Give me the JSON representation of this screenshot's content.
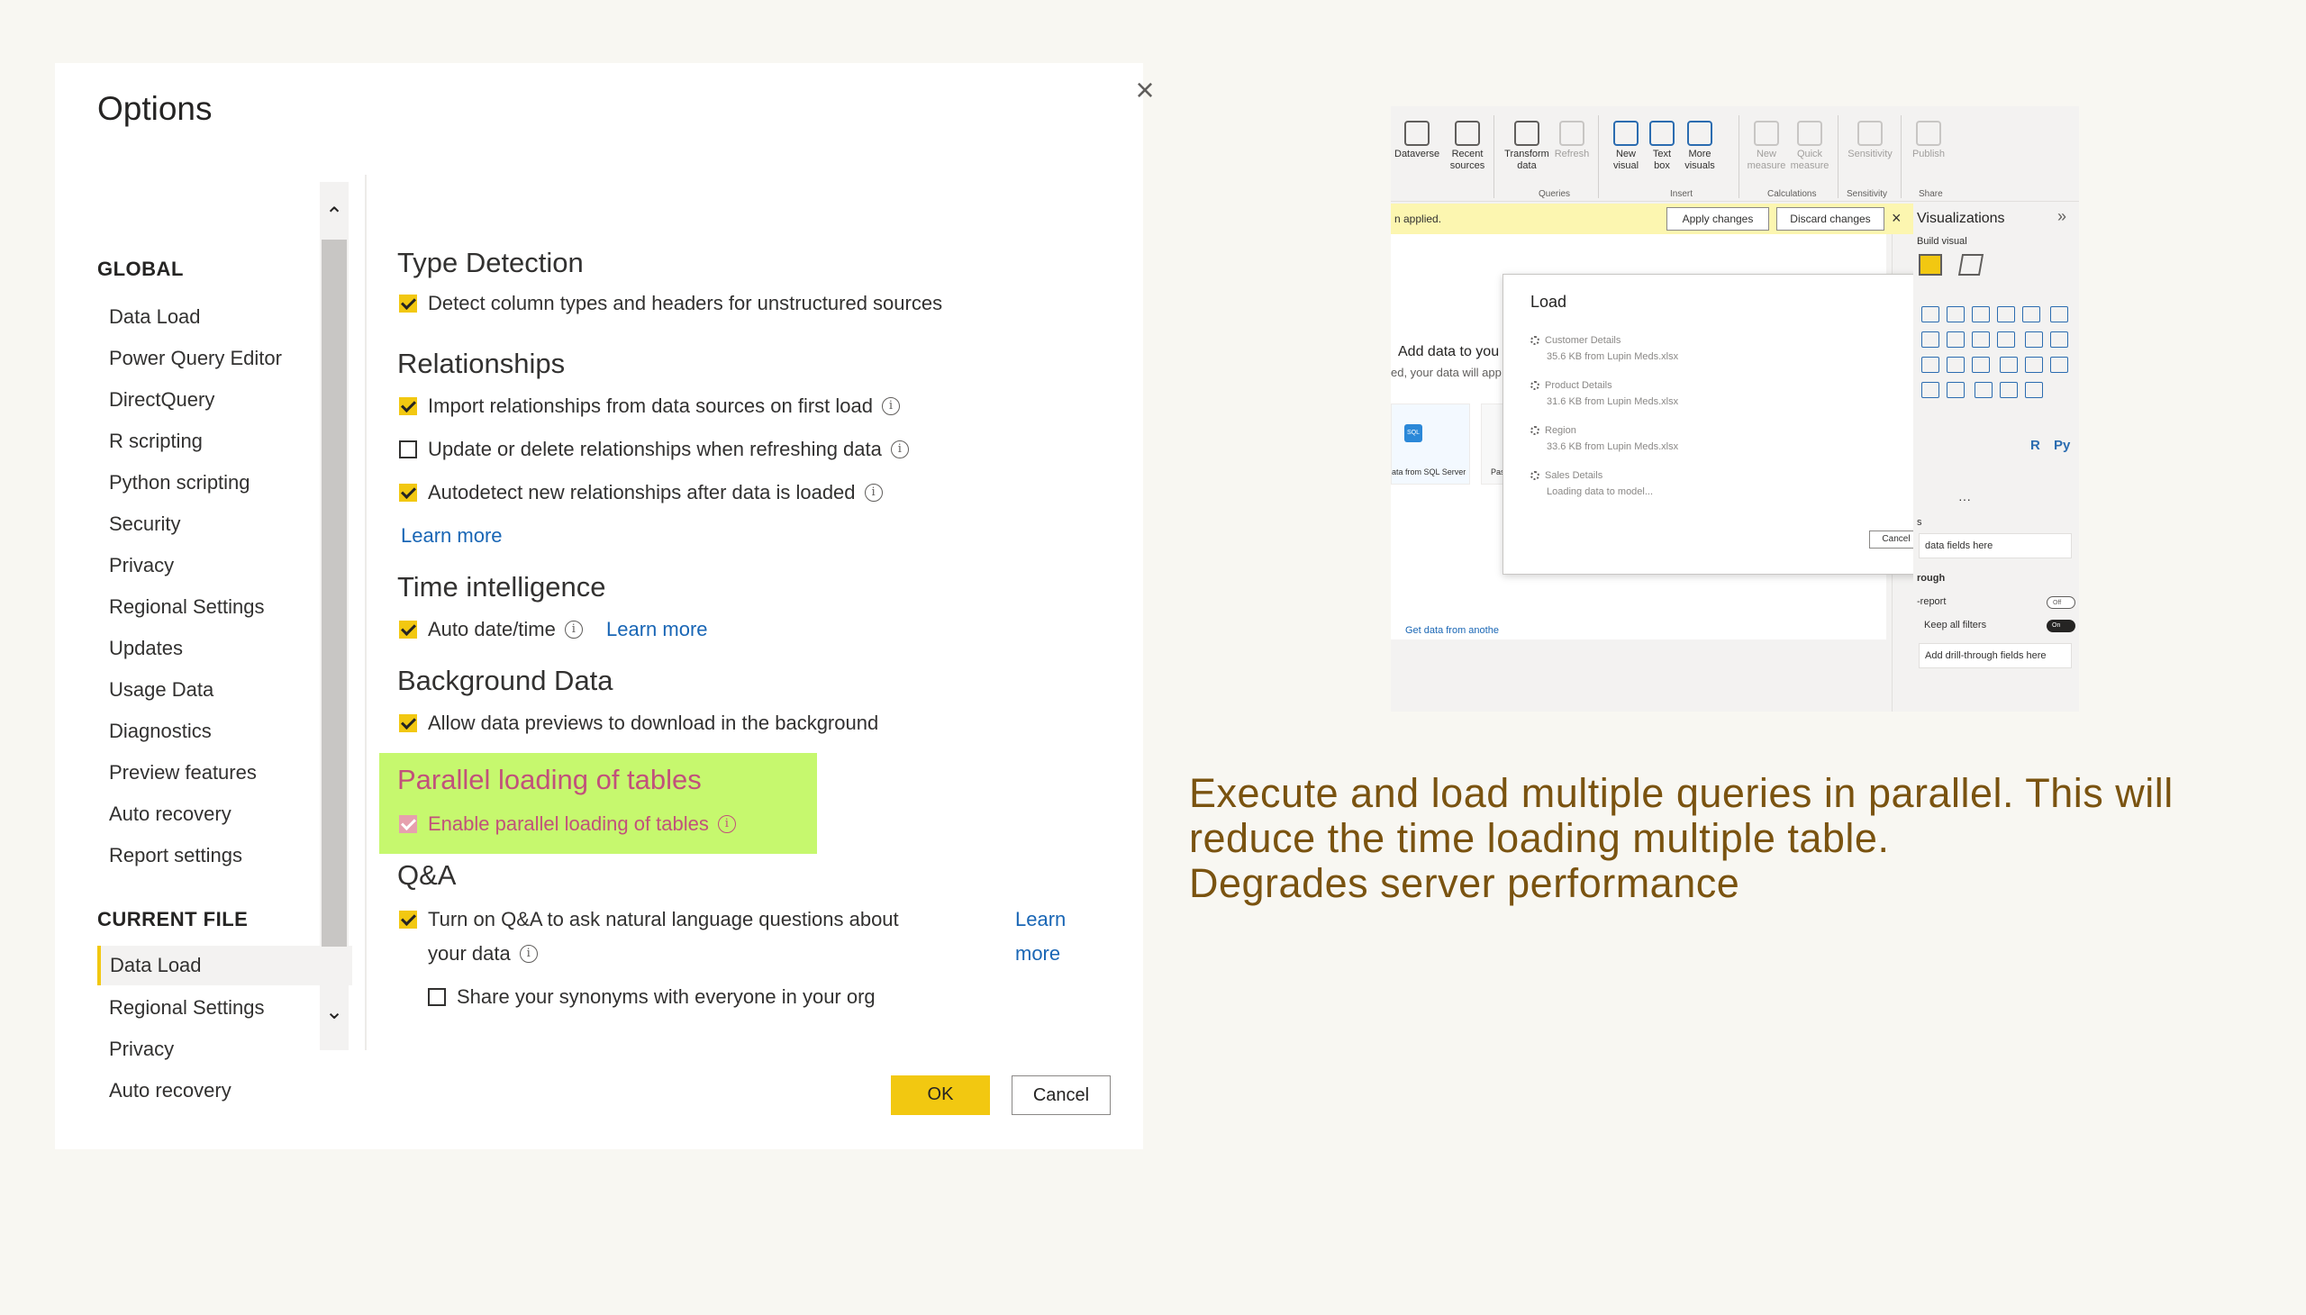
{
  "dialog": {
    "title": "Options",
    "close_glyph": "×",
    "global_header": "GLOBAL",
    "global_items": [
      "Data Load",
      "Power Query Editor",
      "DirectQuery",
      "R scripting",
      "Python scripting",
      "Security",
      "Privacy",
      "Regional Settings",
      "Updates",
      "Usage Data",
      "Diagnostics",
      "Preview features",
      "Auto recovery",
      "Report settings"
    ],
    "current_header": "CURRENT FILE",
    "current_items": [
      "Data Load",
      "Regional Settings",
      "Privacy",
      "Auto recovery"
    ],
    "scroll_up": "⌃",
    "scroll_down": "⌄",
    "sections": {
      "type_detection": {
        "title": "Type Detection",
        "detect": "Detect column types and headers for unstructured sources"
      },
      "relationships": {
        "title": "Relationships",
        "import": "Import relationships from data sources on first load",
        "update": "Update or delete relationships when refreshing data",
        "autodetect": "Autodetect new relationships after data is loaded",
        "learn_more": "Learn more"
      },
      "time_intelligence": {
        "title": "Time intelligence",
        "auto_date": "Auto date/time",
        "learn_more": "Learn more"
      },
      "background_data": {
        "title": "Background Data",
        "allow": "Allow data previews to download in the background"
      },
      "parallel": {
        "title": "Parallel loading of tables",
        "enable": "Enable parallel loading of tables",
        "highlight_color": "#c6f86e"
      },
      "qa": {
        "title": "Q&A",
        "turn_on_1": "Turn on Q&A to ask natural language questions about",
        "turn_on_2": "your data",
        "learn": "Learn",
        "more": "more",
        "share": "Share your synonyms with everyone in your org"
      }
    },
    "info_glyph": "i",
    "ok_label": "OK",
    "cancel_label": "Cancel",
    "accent_color": "#f2c811"
  },
  "pbi": {
    "ribbon": {
      "dataverse": "Dataverse",
      "recent_1": "Recent",
      "recent_2": "sources",
      "transform_1": "Transform",
      "transform_2": "data",
      "refresh": "Refresh",
      "new_visual_1": "New",
      "new_visual_2": "visual",
      "text_box_1": "Text",
      "text_box_2": "box",
      "more_visuals_1": "More",
      "more_visuals_2": "visuals",
      "new_measure_1": "New",
      "new_measure_2": "measure",
      "quick_measure_1": "Quick",
      "quick_measure_2": "measure",
      "sensitivity": "Sensitivity",
      "publish": "Publish",
      "groups": {
        "queries": "Queries",
        "insert": "Insert",
        "calculations": "Calculations",
        "sensitivity": "Sensitivity",
        "share": "Share"
      }
    },
    "banner": {
      "message": "n applied.",
      "apply": "Apply changes",
      "discard": "Discard changes",
      "close": "×"
    },
    "canvas": {
      "add_data": "Add data to you",
      "add_data_sub": "ed, your data will app",
      "card1": "ata from SQL Server",
      "card1_icon": "SQL",
      "card2": "Past",
      "get_data": "Get data from anothe"
    },
    "load_dialog": {
      "title": "Load",
      "close": "×",
      "items": [
        {
          "name": "Customer Details",
          "detail": "35.6 KB from Lupin Meds.xlsx"
        },
        {
          "name": "Product Details",
          "detail": "31.6 KB from Lupin Meds.xlsx"
        },
        {
          "name": "Region",
          "detail": "33.6 KB from Lupin Meds.xlsx"
        },
        {
          "name": "Sales Details",
          "detail": "Loading data to model..."
        }
      ],
      "cancel": "Cancel"
    },
    "vis_pane": {
      "title": "Visualizations",
      "expand": "»",
      "build_visual": "Build visual",
      "r_label": "R",
      "py_label": "Py",
      "more": "···",
      "fields_label": "s",
      "data_fields": "data fields here",
      "drill_through": "rough",
      "cross_report": "-report",
      "cross_toggle": "Off",
      "keep_filters": "Keep all filters",
      "keep_toggle": "On",
      "drill_fields": "Add drill-through fields here"
    }
  },
  "caption": {
    "line1": "Execute and load multiple queries in parallel. This will",
    "line2": "reduce the time loading multiple table.",
    "line3": "Degrades server performance",
    "color": "#7a5310"
  }
}
